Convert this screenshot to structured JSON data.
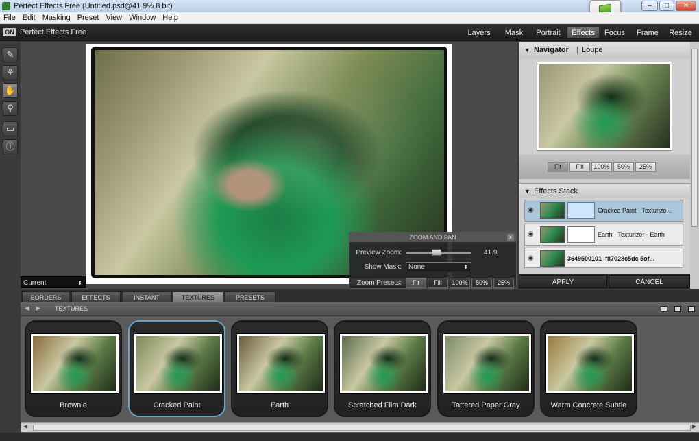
{
  "window": {
    "title": "Perfect Effects Free (Untitled.psd@41.9% 8 bit)"
  },
  "menu": [
    "File",
    "Edit",
    "Masking",
    "Preset",
    "View",
    "Window",
    "Help"
  ],
  "app": {
    "logo": "ON",
    "name": "Perfect Effects Free"
  },
  "modules": [
    {
      "label": "Layers",
      "active": false
    },
    {
      "label": "Mask",
      "active": false
    },
    {
      "label": "Portrait",
      "active": false
    },
    {
      "label": "Effects",
      "active": true
    },
    {
      "label": "Focus",
      "active": false
    },
    {
      "label": "Frame",
      "active": false
    },
    {
      "label": "Resize",
      "active": false
    }
  ],
  "tools": [
    {
      "icon": "brush-icon",
      "glyph": "✎"
    },
    {
      "icon": "mask-tool-icon",
      "glyph": "⚘"
    },
    {
      "icon": "hand-icon",
      "glyph": "✋"
    },
    {
      "icon": "zoom-icon",
      "glyph": "⚲"
    },
    {
      "icon": "compare-icon",
      "glyph": "▭"
    },
    {
      "icon": "info-icon",
      "glyph": "ⓘ"
    }
  ],
  "canvas": {
    "view_select": "Current"
  },
  "zoom_pan": {
    "title": "ZOOM AND PAN",
    "preview_zoom_label": "Preview Zoom:",
    "preview_zoom_value": "41.9",
    "show_mask_label": "Show Mask:",
    "show_mask_value": "None",
    "zoom_presets_label": "Zoom Presets:",
    "presets": [
      "Fit",
      "Fill",
      "100%",
      "50%",
      "25%"
    ]
  },
  "navigator": {
    "title": "Navigator",
    "loupe": "Loupe",
    "buttons": [
      "Fit",
      "Fill",
      "100%",
      "50%",
      "25%"
    ]
  },
  "effects_stack": {
    "title": "Effects Stack",
    "items": [
      {
        "name": "Cracked Paint - Texturize...",
        "selected": true
      },
      {
        "name": "Earth - Texturizer - Earth",
        "selected": false
      },
      {
        "name": "3649500101_f87028c5dc 5of...",
        "selected": false
      }
    ]
  },
  "actions": {
    "apply": "APPLY",
    "cancel": "CANCEL"
  },
  "browser_tabs": [
    {
      "label": "BORDERS",
      "selected": false
    },
    {
      "label": "EFFECTS",
      "selected": false
    },
    {
      "label": "INSTANT",
      "selected": false
    },
    {
      "label": "TEXTURES",
      "selected": true
    },
    {
      "label": "PRESETS",
      "selected": false
    }
  ],
  "browser": {
    "header_label": "TEXTURES",
    "presets": [
      {
        "name": "Brownie",
        "selected": false,
        "tint": "#8a6a3a"
      },
      {
        "name": "Cracked Paint",
        "selected": true,
        "tint": "#7a8a5a"
      },
      {
        "name": "Earth",
        "selected": false,
        "tint": "#6a5a3a"
      },
      {
        "name": "Scratched Film Dark",
        "selected": false,
        "tint": "#5a6a4a"
      },
      {
        "name": "Tattered Paper Gray",
        "selected": false,
        "tint": "#7a8a6a"
      },
      {
        "name": "Warm Concrete Subtle",
        "selected": false,
        "tint": "#9a7a3a"
      }
    ]
  }
}
